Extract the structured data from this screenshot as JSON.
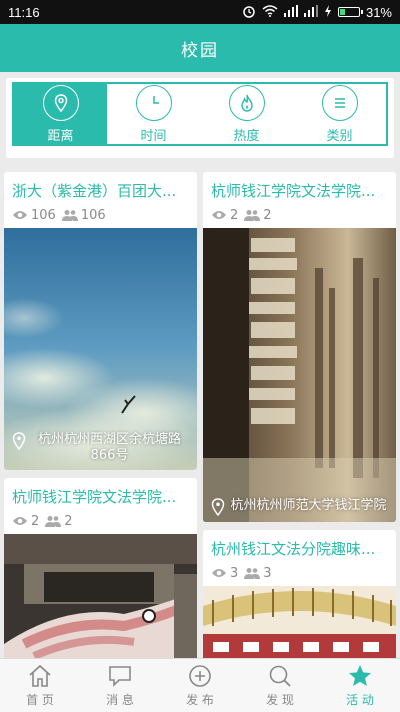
{
  "status_bar": {
    "time": "11:16",
    "battery": "31%",
    "battery_level": 0.31
  },
  "header": {
    "title": "校园"
  },
  "filters": [
    {
      "label": "距离",
      "icon": "location-pin-icon",
      "active": true
    },
    {
      "label": "时间",
      "icon": "clock-icon",
      "active": false
    },
    {
      "label": "热度",
      "icon": "flame-icon",
      "active": false
    },
    {
      "label": "类别",
      "icon": "menu-icon",
      "active": false
    }
  ],
  "cards": [
    {
      "title": "浙大（紫金港）百团大...",
      "views": "106",
      "people": "106",
      "address": "杭州杭州西湖区余杭塘路866号"
    },
    {
      "title": "杭师钱江学院文法学院...",
      "views": "2",
      "people": "2",
      "address": "杭州杭州师范大学钱江学院"
    },
    {
      "title": "杭师钱江学院文法学院...",
      "views": "2",
      "people": "2",
      "address": ""
    },
    {
      "title": "杭州钱江文法分院趣味...",
      "views": "3",
      "people": "3",
      "address": ""
    }
  ],
  "bottom_nav": [
    {
      "label": "首 页",
      "icon": "home-icon",
      "active": false
    },
    {
      "label": "消 息",
      "icon": "message-icon",
      "active": false
    },
    {
      "label": "发 布",
      "icon": "plus-circle-icon",
      "active": false
    },
    {
      "label": "发 现",
      "icon": "search-icon",
      "active": false
    },
    {
      "label": "活 动",
      "icon": "star-icon",
      "active": true
    }
  ],
  "colors": {
    "accent": "#2bbbad",
    "header": "#2bbbad",
    "status_bar": "#111111"
  }
}
